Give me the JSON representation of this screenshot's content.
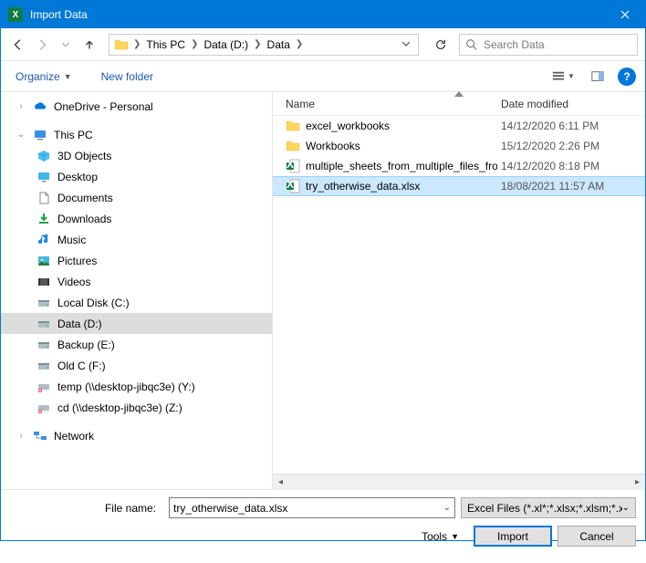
{
  "window": {
    "title": "Import Data"
  },
  "breadcrumb": {
    "items": [
      "This PC",
      "Data (D:)",
      "Data"
    ]
  },
  "search": {
    "placeholder": "Search Data"
  },
  "toolbar": {
    "organize": "Organize",
    "new_folder": "New folder"
  },
  "tree": {
    "onedrive": "OneDrive - Personal",
    "thispc": "This PC",
    "thispc_children": [
      {
        "icon": "3d",
        "label": "3D Objects"
      },
      {
        "icon": "desktop",
        "label": "Desktop"
      },
      {
        "icon": "documents",
        "label": "Documents"
      },
      {
        "icon": "downloads",
        "label": "Downloads"
      },
      {
        "icon": "music",
        "label": "Music"
      },
      {
        "icon": "pictures",
        "label": "Pictures"
      },
      {
        "icon": "videos",
        "label": "Videos"
      },
      {
        "icon": "disk",
        "label": "Local Disk (C:)"
      },
      {
        "icon": "disk",
        "label": "Data (D:)",
        "selected": true
      },
      {
        "icon": "disk",
        "label": "Backup (E:)"
      },
      {
        "icon": "disk",
        "label": "Old C (F:)"
      },
      {
        "icon": "netdisk",
        "label": "temp (\\\\desktop-jibqc3e) (Y:)"
      },
      {
        "icon": "netdisk",
        "label": "cd (\\\\desktop-jibqc3e) (Z:)"
      }
    ],
    "network": "Network"
  },
  "columns": {
    "name": "Name",
    "date": "Date modified"
  },
  "files": [
    {
      "type": "folder",
      "name": "excel_workbooks",
      "date": "14/12/2020 6:11 PM"
    },
    {
      "type": "folder",
      "name": "Workbooks",
      "date": "15/12/2020 2:26 PM"
    },
    {
      "type": "excel",
      "name": "multiple_sheets_from_multiple_files_fro...",
      "date": "14/12/2020 8:18 PM"
    },
    {
      "type": "excel",
      "name": "try_otherwise_data.xlsx",
      "date": "18/08/2021 11:57 AM",
      "selected": true
    }
  ],
  "footer": {
    "filename_label": "File name:",
    "filename_value": "try_otherwise_data.xlsx",
    "filter": "Excel Files (*.xl*;*.xlsx;*.xlsm;*.x",
    "tools": "Tools",
    "import": "Import",
    "cancel": "Cancel"
  }
}
